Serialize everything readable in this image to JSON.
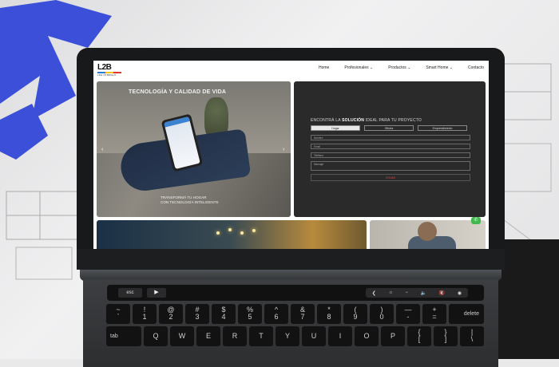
{
  "nav": {
    "logo_text": "L2B",
    "logo_sub": "LIFE TO BRIGHT",
    "items": [
      "Home",
      "Profesionales",
      "Productos",
      "Smart Home",
      "Contacto"
    ]
  },
  "hero": {
    "title": "TECNOLOGÍA Y CALIDAD DE VIDA",
    "subtitle_line1": "TRANSFORMÁ TU HOGAR",
    "subtitle_line2": "CON TECNOLOGÍA INTELIGENTE",
    "prev_arrow": "‹",
    "next_arrow": "›"
  },
  "form": {
    "title_pre": "ENCONTRÁ LA ",
    "title_bold": "SOLUCIÓN",
    "title_post": " IDEAL PARA TU PROYECTO",
    "tabs": [
      "Hogar",
      "Oficina",
      "Emprendimiento"
    ],
    "fields": [
      "Nombre",
      "Email",
      "Teléfono",
      "Mensaje"
    ],
    "submit": "ENVIAR"
  },
  "whatsapp_icon": "whatsapp-icon",
  "keyboard": {
    "esc": "esc",
    "play": "▶",
    "strip": [
      "❮",
      "☼",
      "−",
      "🔈",
      "🔇",
      "◉"
    ],
    "row1": [
      {
        "top": "~",
        "bottom": "`"
      },
      {
        "top": "!",
        "bottom": "1"
      },
      {
        "top": "@",
        "bottom": "2"
      },
      {
        "top": "#",
        "bottom": "3"
      },
      {
        "top": "$",
        "bottom": "4"
      },
      {
        "top": "%",
        "bottom": "5"
      },
      {
        "top": "^",
        "bottom": "6"
      },
      {
        "top": "&",
        "bottom": "7"
      },
      {
        "top": "*",
        "bottom": "8"
      },
      {
        "top": "(",
        "bottom": "9"
      },
      {
        "top": ")",
        "bottom": "0"
      },
      {
        "top": "—",
        "bottom": "-"
      },
      {
        "top": "+",
        "bottom": "="
      }
    ],
    "delete": "delete",
    "tab": "tab",
    "row2": [
      "Q",
      "W",
      "E",
      "R",
      "T",
      "Y",
      "U",
      "I",
      "O",
      "P"
    ],
    "row2_extra": [
      {
        "top": "{",
        "bottom": "["
      },
      {
        "top": "}",
        "bottom": "]"
      },
      {
        "top": "|",
        "bottom": "\\"
      }
    ]
  }
}
